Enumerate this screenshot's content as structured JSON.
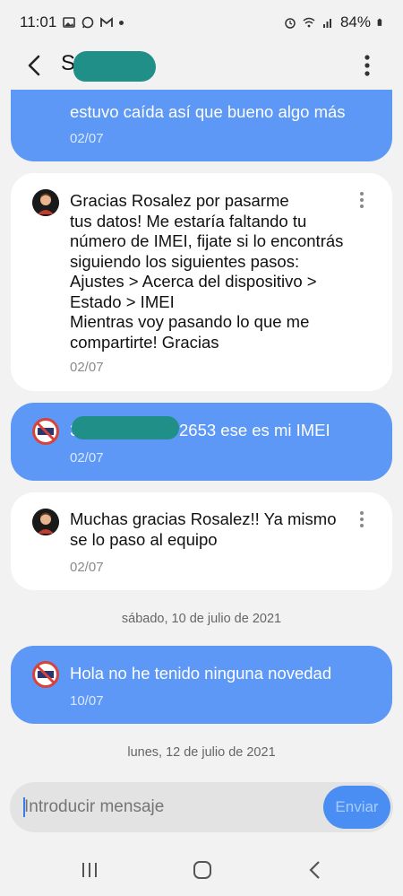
{
  "status_bar": {
    "time": "11:01",
    "battery": "84%",
    "left_icons": [
      "image-icon",
      "whatsapp-icon",
      "gmail-icon",
      "dot-icon"
    ],
    "right_icons": [
      "alarm-icon",
      "wifi-icon",
      "signal-icon",
      "battery-icon"
    ]
  },
  "header": {
    "contact_name": "S",
    "back_icon": "back-arrow-icon",
    "more_icon": "more-vert-icon"
  },
  "messages": [
    {
      "type": "outgoing",
      "text": "estuvo caída así que bueno algo más",
      "date": "02/07"
    },
    {
      "type": "incoming",
      "text": "Gracias Rosalez por pasarme\ntus datos! Me estaría faltando tu\nnúmero de IMEI, fijate si lo encontrás\nsiguiendo los siguientes pasos:\nAjustes > Acerca del dispositivo >\nEstado > IMEI\nMientras voy pasando lo que me\ncompartirte! Gracias",
      "date": "02/07"
    },
    {
      "type": "outgoing",
      "text_prefix": "3",
      "text": "2653 ese es mi IMEI",
      "date": "02/07"
    },
    {
      "type": "incoming",
      "text": "Muchas gracias Rosalez!! Ya mismo\nse lo paso al equipo",
      "date": "02/07"
    },
    {
      "type": "outgoing",
      "text": "Hola no he tenido ninguna novedad",
      "date": "10/07"
    }
  ],
  "date_separators": [
    "sábado, 10 de julio de 2021",
    "lunes, 12 de julio de 2021"
  ],
  "composer": {
    "placeholder": "Introducir mensaje",
    "send_label": "Enviar"
  },
  "navbar": [
    "recents-icon",
    "home-icon",
    "back-icon"
  ],
  "colors": {
    "outgoing_bubble": "#5d98f6",
    "incoming_bubble": "#ffffff",
    "send_button": "#4a8ef3",
    "redaction": "#1f8f88"
  }
}
